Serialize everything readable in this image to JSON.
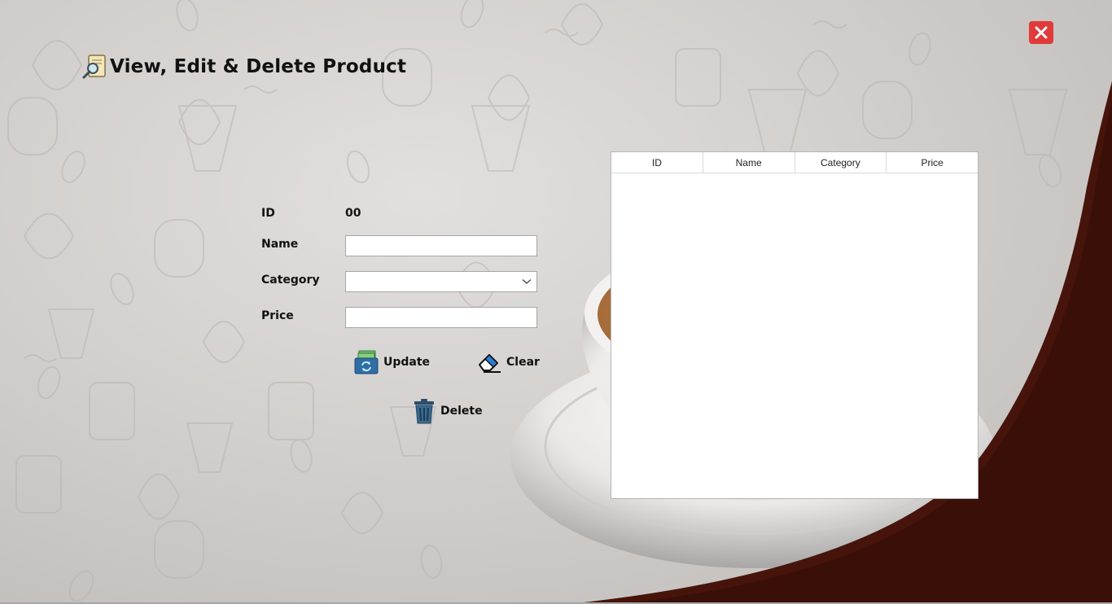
{
  "window": {
    "title": "View, Edit & Delete Product",
    "title_icon": "search-document-icon",
    "close_icon": "close-icon"
  },
  "form": {
    "id_label": "ID",
    "id_value": "00",
    "name_label": "Name",
    "name_value": "",
    "category_label": "Category",
    "category_value": "",
    "price_label": "Price",
    "price_value": ""
  },
  "buttons": {
    "update_label": "Update",
    "update_icon": "refresh-cash-icon",
    "clear_label": "Clear",
    "clear_icon": "eraser-icon",
    "delete_label": "Delete",
    "delete_icon": "trash-icon"
  },
  "table": {
    "columns": [
      "ID",
      "Name",
      "Category",
      "Price"
    ],
    "rows": []
  },
  "colors": {
    "close_button": "#e03a3a",
    "coffee_brown": "#3a0f08",
    "background": "#d2cfcd"
  }
}
